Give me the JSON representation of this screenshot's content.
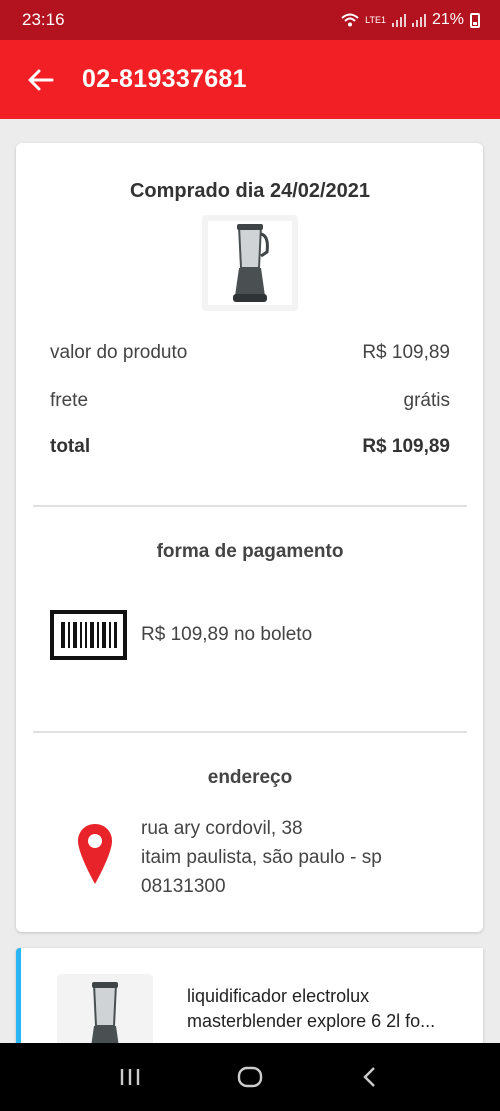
{
  "status_bar": {
    "time": "23:16",
    "network": "LTE1",
    "battery": "21%"
  },
  "header": {
    "title": "02-819337681",
    "back_icon": "arrow-left-icon"
  },
  "order": {
    "purchased_label": "Comprado dia 24/02/2021",
    "product_label": "valor do produto",
    "product_value": "R$ 109,89",
    "shipping_label": "frete",
    "shipping_value": "grátis",
    "total_label": "total",
    "total_value": "R$ 109,89"
  },
  "payment": {
    "title": "forma de pagamento",
    "icon": "barcode-icon",
    "text": "R$ 109,89 no boleto"
  },
  "address": {
    "title": "endereço",
    "icon": "location-pin-icon",
    "line1": "rua ary cordovil, 38",
    "line2": "itaim paulista, são paulo - sp",
    "line3": "08131300"
  },
  "item": {
    "name_line1": "liquidificador electrolux",
    "name_line2": "masterblender explore 6 2l fo..."
  },
  "colors": {
    "header": "#f21f24",
    "status_bar": "#b3131e",
    "pin": "#e8242a",
    "accent_border": "#29b6f6"
  }
}
